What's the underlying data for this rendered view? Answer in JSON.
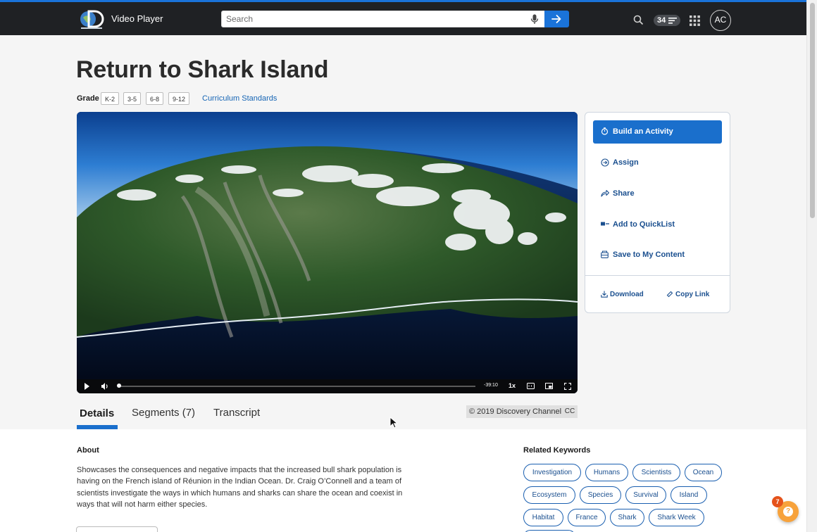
{
  "header": {
    "app_title": "Video Player",
    "search_placeholder": "Search",
    "points": "34",
    "avatar_initials": "AC"
  },
  "page": {
    "title": "Return to Shark Island",
    "grade_label": "Grade",
    "grades": [
      "K-2",
      "3-5",
      "6-8",
      "9-12"
    ],
    "curriculum_link": "Curriculum Standards"
  },
  "player": {
    "time_remaining": "-39:10",
    "speed": "1x",
    "progress": 0.0
  },
  "actions": {
    "build_activity": "Build an Activity",
    "assign": "Assign",
    "share": "Share",
    "add_quicklist": "Add to QuickList",
    "save_content": "Save to My Content",
    "download": "Download",
    "copy_link": "Copy Link"
  },
  "tabs": {
    "details": "Details",
    "segments": "Segments (7)",
    "transcript": "Transcript",
    "copyright": "© 2019 Discovery Channel",
    "cc": "CC"
  },
  "about": {
    "heading": "About",
    "text": "Showcases the consequences and negative impacts that the increased bull shark population is having on the French island of Réunion in the Indian Ocean. Dr. Craig O’Connell and a team of scientists investigate the ways in which humans and sharks can share the ocean and coexist in ways that will not harm either species."
  },
  "keywords": {
    "heading": "Related Keywords",
    "items": [
      "Investigation",
      "Humans",
      "Scientists",
      "Ocean",
      "Ecosystem",
      "Species",
      "Survival",
      "Island",
      "Habitat",
      "France",
      "Shark",
      "Shark Week"
    ]
  },
  "help": {
    "badge_count": "7",
    "icon_glyph": "?"
  },
  "colors": {
    "accent": "#1a6fcc",
    "nav_bg": "#1f2124",
    "help": "#f7a23b"
  }
}
